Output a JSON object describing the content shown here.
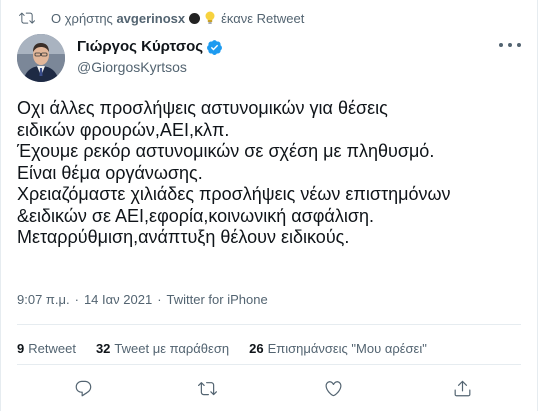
{
  "retweet_bar": {
    "prefix": "Ο χρήστης",
    "user": "avgerinosx",
    "suffix": "έκανε Retweet"
  },
  "author": {
    "display_name": "Γιώργος Κύρτσος",
    "handle": "@GiorgosKyrtsos",
    "verified": true
  },
  "tweet": {
    "lines": [
      "Οχι άλλες προσλήψεις αστυνομικών για θέσεις",
      "ειδικών φρουρών,ΑΕΙ,κλπ.",
      "Έχουμε ρεκόρ αστυνομικών σε σχέση με πληθυσμό.",
      "Είναι θέμα οργάνωσης.",
      "Χρειαζόμαστε χιλιάδες προσλήψεις νέων επιστημόνων",
      "&ειδικών σε ΑΕΙ,εφορία,κοινωνική ασφάλιση.",
      "Μεταρρύθμιση,ανάπτυξη θέλουν ειδικούς."
    ]
  },
  "meta": {
    "time": "9:07 π.μ.",
    "separator": "·",
    "date": "14 Ιαν 2021",
    "source": "Twitter for iPhone"
  },
  "stats": {
    "retweets_count": "9",
    "retweets_label": "Retweet",
    "quotes_count": "32",
    "quotes_label": "Tweet με παράθεση",
    "likes_count": "26",
    "likes_label": "Επισημάνσεις \"Μου αρέσει\""
  },
  "icons": {
    "reply": "reply-icon",
    "retweet": "retweet-icon",
    "like": "heart-icon",
    "share": "share-icon",
    "more": "more-icon",
    "verified": "verified-badge-icon"
  },
  "colors": {
    "verified_blue": "#1d9bf0",
    "secondary_text": "#536471",
    "divider": "#e6ecf0"
  }
}
